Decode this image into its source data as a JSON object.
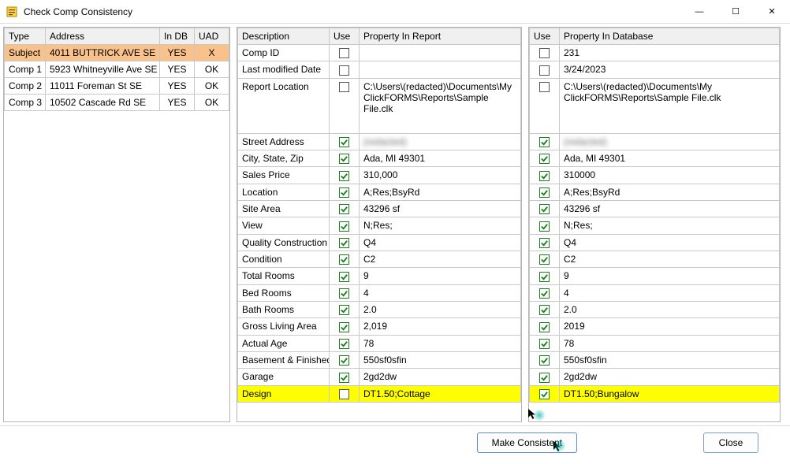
{
  "window": {
    "title": "Check Comp Consistency",
    "min": "—",
    "max": "☐",
    "close": "✕"
  },
  "left": {
    "headers": {
      "type": "Type",
      "address": "Address",
      "indb": "In DB",
      "uad": "UAD"
    },
    "rows": [
      {
        "type": "Subject",
        "address": "4011 BUTTRICK AVE SE",
        "indb": "YES",
        "uad": "X"
      },
      {
        "type": "Comp 1",
        "address": "5923 Whitneyville Ave SE",
        "indb": "YES",
        "uad": "OK"
      },
      {
        "type": "Comp 2",
        "address": "11011 Foreman St SE",
        "indb": "YES",
        "uad": "OK"
      },
      {
        "type": "Comp 3",
        "address": "10502 Cascade Rd SE",
        "indb": "YES",
        "uad": "OK"
      }
    ]
  },
  "mid": {
    "headers": {
      "desc": "Description",
      "use": "Use",
      "prop": "Property In Report"
    }
  },
  "right": {
    "headers": {
      "use": "Use",
      "prop": "Property In  Database"
    }
  },
  "rows": [
    {
      "desc": "Comp ID",
      "use1": false,
      "val1": "",
      "use2": false,
      "val2": "231"
    },
    {
      "desc": "Last modified Date",
      "use1": false,
      "val1": "",
      "use2": false,
      "val2": "3/24/2023"
    },
    {
      "desc": "Report Location",
      "use1": false,
      "val1": "C:\\Users\\(redacted)\\Documents\\My ClickFORMS\\Reports\\Sample File.clk",
      "use2": false,
      "val2": "C:\\Users\\(redacted)\\Documents\\My ClickFORMS\\Reports\\Sample File.clk",
      "tall": true
    },
    {
      "desc": "Street Address",
      "use1": true,
      "val1": "(redacted)",
      "use2": true,
      "val2": "(redacted)",
      "blur": true
    },
    {
      "desc": "City, State, Zip",
      "use1": true,
      "val1": "Ada, MI 49301",
      "use2": true,
      "val2": "Ada, MI 49301"
    },
    {
      "desc": "Sales Price",
      "use1": true,
      "val1": "310,000",
      "use2": true,
      "val2": "310000"
    },
    {
      "desc": "Location",
      "use1": true,
      "val1": "A;Res;BsyRd",
      "use2": true,
      "val2": "A;Res;BsyRd"
    },
    {
      "desc": "Site Area",
      "use1": true,
      "val1": "43296 sf",
      "use2": true,
      "val2": "43296 sf"
    },
    {
      "desc": "View",
      "use1": true,
      "val1": "N;Res;",
      "use2": true,
      "val2": "N;Res;"
    },
    {
      "desc": "Quality Construction",
      "use1": true,
      "val1": "Q4",
      "use2": true,
      "val2": "Q4"
    },
    {
      "desc": "Condition",
      "use1": true,
      "val1": "C2",
      "use2": true,
      "val2": "C2"
    },
    {
      "desc": "Total Rooms",
      "use1": true,
      "val1": "9",
      "use2": true,
      "val2": "9"
    },
    {
      "desc": "Bed Rooms",
      "use1": true,
      "val1": "4",
      "use2": true,
      "val2": "4"
    },
    {
      "desc": "Bath Rooms",
      "use1": true,
      "val1": "2.0",
      "use2": true,
      "val2": "2.0"
    },
    {
      "desc": "Gross Living Area",
      "use1": true,
      "val1": "2,019",
      "use2": true,
      "val2": "2019"
    },
    {
      "desc": "Actual Age",
      "use1": true,
      "val1": "78",
      "use2": true,
      "val2": "78"
    },
    {
      "desc": "Basement & Finished",
      "use1": true,
      "val1": "550sf0sfin",
      "use2": true,
      "val2": "550sf0sfin"
    },
    {
      "desc": "Garage",
      "use1": true,
      "val1": "2gd2dw",
      "use2": true,
      "val2": "2gd2dw"
    },
    {
      "desc": "Design",
      "use1": false,
      "val1": "DT1.50;Cottage",
      "use2": true,
      "val2": "DT1.50;Bungalow",
      "hl": true
    }
  ],
  "buttons": {
    "make": "Make Consistent",
    "close": "Close"
  }
}
